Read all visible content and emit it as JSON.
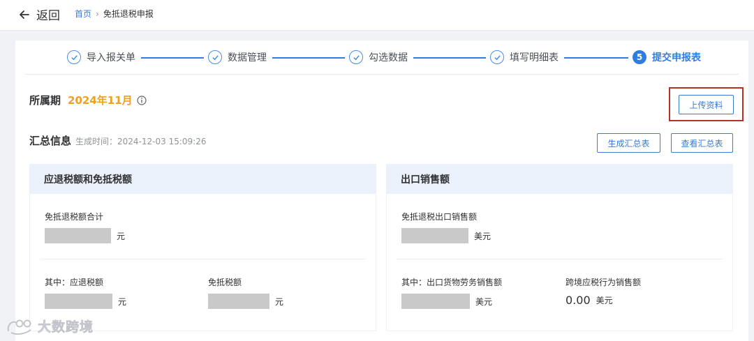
{
  "header": {
    "back_label": "返回",
    "breadcrumb": {
      "home": "首页",
      "separator": "›",
      "current": "免抵退税申报"
    }
  },
  "steps": [
    {
      "label": "导入报关单",
      "status": "done"
    },
    {
      "label": "数据管理",
      "status": "done"
    },
    {
      "label": "勾选数据",
      "status": "done"
    },
    {
      "label": "填写明细表",
      "status": "done"
    },
    {
      "label": "提交申报表",
      "status": "active",
      "number": "5"
    }
  ],
  "period": {
    "label": "所属期",
    "value": "2024年11月"
  },
  "actions": {
    "upload_label": "上传资料",
    "generate_label": "生成汇总表",
    "view_label": "查看汇总表"
  },
  "summary": {
    "title": "汇总信息",
    "time_label": "生成时间：",
    "time_value": "2024-12-03 15:09:26"
  },
  "refund_card": {
    "title": "应退税额和免抵税额",
    "total_label": "免抵退税额合计",
    "total_unit": "元",
    "refund_label": "其中：应退税额",
    "refund_unit": "元",
    "exempt_label": "免抵税额",
    "exempt_unit": "元"
  },
  "sales_card": {
    "title": "出口销售额",
    "total_label": "免抵退税出口销售额",
    "total_unit": "美元",
    "goods_label": "其中：出口货物劳务销售额",
    "goods_unit": "美元",
    "crossborder_label": "跨境应税行为销售额",
    "crossborder_value": "0.00",
    "crossborder_unit": "美元"
  },
  "watermark": {
    "text": "大数跨境"
  },
  "colors": {
    "primary": "#2f7de1",
    "accent": "#f0a020",
    "highlight_border": "#b5322a",
    "card_header": "#ebf1fa"
  },
  "icons": {
    "back": "arrow-left-icon",
    "step_done": "check-circle-icon",
    "info": "info-circle-icon"
  }
}
